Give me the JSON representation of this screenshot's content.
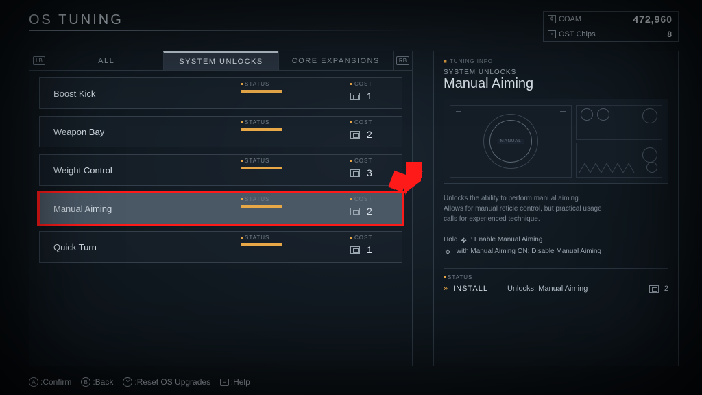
{
  "header": {
    "title": "OS TUNING"
  },
  "currency": {
    "coam_label": "COAM",
    "coam_value": "472,960",
    "chips_label": "OST Chips",
    "chips_value": "8"
  },
  "tabs": {
    "bumper_left": "LB",
    "bumper_right": "RB",
    "items": [
      {
        "label": "ALL"
      },
      {
        "label": "SYSTEM UNLOCKS"
      },
      {
        "label": "CORE EXPANSIONS"
      }
    ],
    "active_index": 1
  },
  "list": {
    "status_label": "STATUS",
    "cost_label": "COST",
    "items": [
      {
        "name": "Boost Kick",
        "cost": "1",
        "selected": false
      },
      {
        "name": "Weapon Bay",
        "cost": "2",
        "selected": false
      },
      {
        "name": "Weight Control",
        "cost": "3",
        "selected": false
      },
      {
        "name": "Manual Aiming",
        "cost": "2",
        "selected": true
      },
      {
        "name": "Quick Turn",
        "cost": "1",
        "selected": false
      }
    ]
  },
  "info": {
    "header_label": "TUNING INFO",
    "category": "SYSTEM UNLOCKS",
    "title": "Manual Aiming",
    "reticle_label": "MANUAL",
    "description_l1": "Unlocks the ability to perform manual aiming.",
    "description_l2": "Allows for manual reticle control, but practical usage",
    "description_l3": "calls for experienced technique.",
    "hint_l1_pre": "Hold ",
    "hint_l1_post": ": Enable Manual Aiming",
    "hint_l2_pre": "",
    "hint_l2_post": " with Manual Aiming ON: Disable Manual Aiming",
    "status_label": "STATUS",
    "install_label": "INSTALL",
    "unlocks_text": "Unlocks: Manual Aiming",
    "install_cost": "2"
  },
  "footer": {
    "confirm": ":Confirm",
    "back": ":Back",
    "reset": ":Reset OS Upgrades",
    "help": ":Help",
    "btn_a": "A",
    "btn_b": "B",
    "btn_y": "Y",
    "btn_menu": "≡"
  }
}
